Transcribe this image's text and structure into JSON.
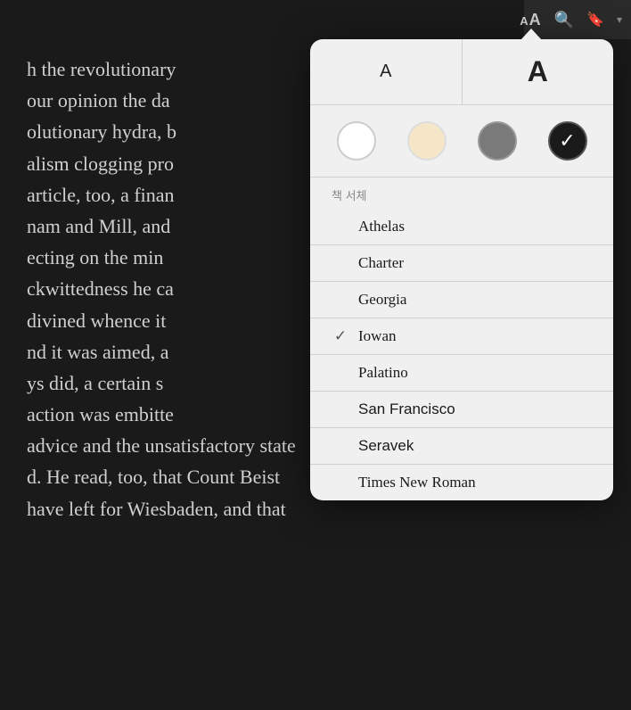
{
  "toolbar": {
    "font_size_icon": "A A",
    "search_icon": "⌕",
    "bookmark_icon": "🔖"
  },
  "book": {
    "lines": [
      "h the revolutionary",
      "our opinion the da",
      "olutionary hydra, b",
      "alism clogging pro",
      "article, too, a finan",
      "nam and Mill, and",
      "ecting on the min",
      "ckwittedness he ca",
      "divined whence it",
      "nd it was aimed, a",
      "ys did, a certain s",
      "action was embitte",
      "advice and the unsatisfactory state",
      "d. He read, too, that Count Beist",
      "have left for Wiesbaden, and that"
    ]
  },
  "popup": {
    "font_small_label": "A",
    "font_large_label": "A",
    "themes": [
      {
        "id": "white",
        "label": "White theme",
        "selected": false
      },
      {
        "id": "sepia",
        "label": "Sepia theme",
        "selected": false
      },
      {
        "id": "gray",
        "label": "Gray theme",
        "selected": false
      },
      {
        "id": "dark",
        "label": "Dark theme",
        "selected": true
      }
    ],
    "font_section_label": "책 서체",
    "fonts": [
      {
        "name": "Athelas",
        "class": "font-athelas",
        "selected": false
      },
      {
        "name": "Charter",
        "class": "font-charter",
        "selected": false
      },
      {
        "name": "Georgia",
        "class": "font-georgia",
        "selected": false
      },
      {
        "name": "Iowan",
        "class": "font-iowan",
        "selected": true
      },
      {
        "name": "Palatino",
        "class": "font-palatino",
        "selected": false
      },
      {
        "name": "San Francisco",
        "class": "font-sf",
        "selected": false
      },
      {
        "name": "Seravek",
        "class": "font-seravek",
        "selected": false
      },
      {
        "name": "Times New Roman",
        "class": "font-tnr",
        "selected": false
      }
    ]
  }
}
